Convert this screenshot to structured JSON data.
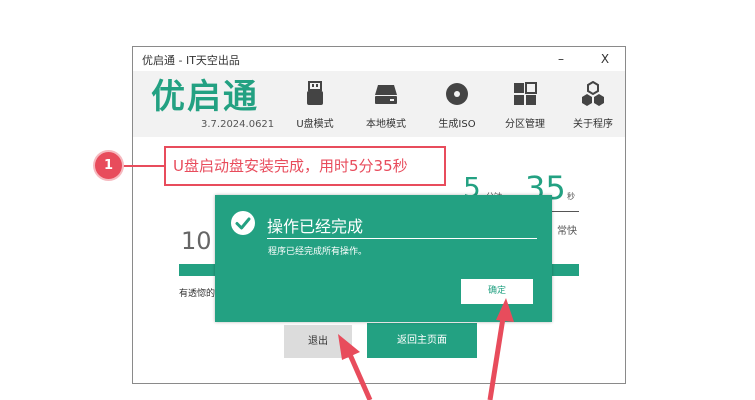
{
  "window": {
    "title": "优启通 - IT天空出品",
    "minimize": "–",
    "close": "X"
  },
  "header": {
    "logo": "优启通",
    "version": "3.7.2024.0621",
    "tools": [
      {
        "label": "U盘模式",
        "icon": "usb-drive-icon"
      },
      {
        "label": "本地模式",
        "icon": "hard-disk-icon"
      },
      {
        "label": "生成ISO",
        "icon": "disc-icon"
      },
      {
        "label": "分区管理",
        "icon": "partition-grid-icon"
      },
      {
        "label": "关于程序",
        "icon": "hexagon-cluster-icon"
      }
    ]
  },
  "main": {
    "left_number": "10",
    "time_min": "5",
    "time_min_unit": "分钟",
    "time_sec": "35",
    "time_sec_unit": "秒",
    "speed": "常快",
    "tip": "有透惚的",
    "exit_label": "退出",
    "home_label": "返回主页面"
  },
  "dialog": {
    "title": "操作已经完成",
    "message": "程序已经完成所有操作。",
    "ok_label": "确定"
  },
  "annotation": {
    "step": "1",
    "text": "U盘启动盘安装完成，用时5分35秒"
  },
  "colors": {
    "accent": "#23a182",
    "annotation": "#e84c5c"
  }
}
